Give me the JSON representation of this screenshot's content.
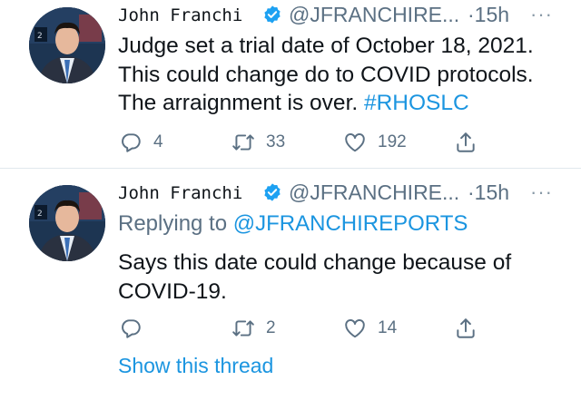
{
  "tweets": [
    {
      "author_name": "John Franchi",
      "handle": "@JFRANCHIRE...",
      "time": "15h",
      "more": "···",
      "text": "Judge set a trial date of October 18, 2021. This could change do to COVID protocols. The arraignment is over. ",
      "hashtag": "#RHOSLC",
      "replies": "4",
      "retweets": "33",
      "likes": "192"
    },
    {
      "author_name": "John Franchi",
      "handle": "@JFRANCHIRE...",
      "time": "15h",
      "more": "···",
      "replying_prefix": "Replying to ",
      "replying_handle": "@JFRANCHIREPORTS",
      "text": "Says this date could change because of COVID-19.",
      "replies": "",
      "retweets": "2",
      "likes": "14",
      "show_thread": "Show this thread"
    }
  ],
  "colors": {
    "link": "#1b95e0",
    "muted": "#5b7083",
    "verified": "#1da1f2"
  },
  "icons": [
    "reply-icon",
    "retweet-icon",
    "like-icon",
    "share-icon",
    "verified-badge-icon"
  ]
}
